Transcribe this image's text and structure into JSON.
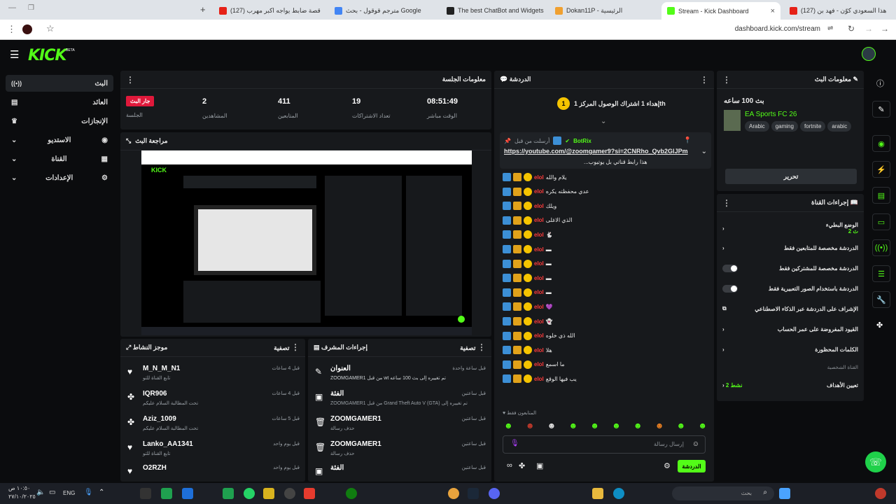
{
  "browser": {
    "tabs": [
      {
        "title": "(127) هذا السعودي كوّن - فهد بن",
        "color": "#e62117",
        "active": false
      },
      {
        "title": "Stream - Kick Dashboard",
        "color": "#53fc18",
        "active": true
      },
      {
        "title": "Dokan11P - الرئيسية",
        "color": "#f0a030",
        "active": false
      },
      {
        "title": "The best ChatBot and Widgets",
        "color": "#222222",
        "active": false
      },
      {
        "title": "مترجم قوقول - بحث Google",
        "color": "#4285f4",
        "active": false
      },
      {
        "title": "(127) قصة ضابط يواجه اكبر مهرب",
        "color": "#e62117",
        "active": false
      }
    ],
    "url": "dashboard.kick.com/stream"
  },
  "header": {
    "logo": "KICK",
    "beta": "BETA"
  },
  "nav": [
    {
      "label": "البث",
      "icon": "live-icon"
    },
    {
      "label": "العائد",
      "icon": "wallet-icon"
    },
    {
      "label": "الإنجازات",
      "icon": "trophy-icon"
    },
    {
      "label": "الاستديو",
      "icon": "studio-icon"
    },
    {
      "label": "القناة",
      "icon": "channel-icon"
    },
    {
      "label": "الإعدادات",
      "icon": "gear-icon"
    }
  ],
  "session": {
    "title": "معلومات الجلسة",
    "live_badge": "جار البث",
    "session_label": "الجلسة",
    "stats": [
      {
        "value": "2",
        "label": "المشاهدين"
      },
      {
        "value": "411",
        "label": "المتابعين"
      },
      {
        "value": "19",
        "label": "تعداد الاشتراكات"
      },
      {
        "value": "08:51:49",
        "label": "الوقت مباشر"
      }
    ]
  },
  "preview": {
    "title": "مراجعة البث"
  },
  "activity": {
    "title": "موجز النشاط",
    "filter": "تصفية",
    "items": [
      {
        "name": "M_N_M_N1",
        "sub": "تابع القناة للتو",
        "time": "قبل 4 ساعات",
        "icon": "heart-icon"
      },
      {
        "name": "IQR906",
        "sub": "تحت المطالبة السلام عليكم",
        "time": "قبل 4 ساعات",
        "icon": "gift-icon"
      },
      {
        "name": "Aziz_1009",
        "sub": "تحت المطالبة السلام عليكم",
        "time": "قبل 5 ساعات",
        "icon": "gift-icon"
      },
      {
        "name": "Lanko_AA1341",
        "sub": "تابع القناة للتو",
        "time": "قبل يوم واحد",
        "icon": "heart-icon"
      },
      {
        "name": "O2RZH",
        "sub": "",
        "time": "قبل يوم واحد",
        "icon": "heart-icon"
      }
    ]
  },
  "mod_actions": {
    "title": "إجراءات المشرف",
    "filter": "تصفية",
    "items": [
      {
        "name": "العنوان",
        "sub": "ZOOMGAMER1 من قبل wt تم تغييره إلى بث 100 ساعه",
        "time": "قبل ساعة واحدة",
        "icon": "edit-icon"
      },
      {
        "name": "الفئة",
        "sub": "ZOOMGAMER1 من قبل Grand Theft Auto V (GTA) تم تغييره إلى",
        "time": "قبل ساعتين",
        "icon": "category-icon"
      },
      {
        "name": "ZOOMGAMER1",
        "sub": "حذف رسالة",
        "time": "قبل ساعتين",
        "icon": "trash-icon"
      },
      {
        "name": "ZOOMGAMER1",
        "sub": "حذف رسالة",
        "time": "قبل ساعتين",
        "icon": "trash-icon"
      },
      {
        "name": "الفئة",
        "sub": "",
        "time": "قبل ساعتين",
        "icon": "category-icon"
      }
    ]
  },
  "chat": {
    "title": "الدردشة",
    "goal_badge": "1",
    "goal_text": "إهداء 1 اشتراك الوصول المركز 1th",
    "pinned_by": "أرسلت من قبل",
    "pinned_user": "BotRix",
    "pinned_link": "https://youtube.com/@zoomgamer9?si=2CNRho_Qvb2GlJPm",
    "pinned_desc": "...هذا رابط قناتي بل يوتيوب",
    "username": "elol",
    "messages": [
      "يلام والله",
      "عدي محفظته يكره",
      "ويلك",
      "الذي الاغلى",
      "🐇",
      "▬",
      "▬",
      "▬",
      "▬",
      "💜",
      "👻",
      "الله ذي خلوه",
      "هلا",
      "ما اسمع",
      "يب فيها الوقع"
    ],
    "followers_only": "المتابعون فقط",
    "input_placeholder": "إرسال رسالة",
    "send_button": "الدردشة"
  },
  "stream_info": {
    "title": "معلومات البث",
    "stream_title": "بث 100 ساعه",
    "category": "EA Sports FC 26",
    "tags": [
      "Arabic",
      "gaming",
      "fortnite",
      "arabic"
    ],
    "edit_button": "تحرير"
  },
  "channel_actions": {
    "title": "إجراءات القناة",
    "slow_mode": "الوضع البطيء",
    "slow_mode_value": "2 ث",
    "items": [
      {
        "label": "الدردشة مخصصة للمتابعين فقط",
        "control": "chevron"
      },
      {
        "label": "الدردشة مخصصة للمشتركين فقط",
        "control": "toggle"
      },
      {
        "label": "الدردشة باستخدام الصور التعبيرية فقط",
        "control": "toggle"
      },
      {
        "label": "الإشراف على الدردشة عبر الذكاء الاصطناعي",
        "control": "external"
      },
      {
        "label": "القيود المفروضة على عمر الحساب",
        "control": "chevron"
      },
      {
        "label": "الكلمات المحظورة",
        "control": "chevron"
      }
    ],
    "section_label": "القناة الشخصية",
    "goals_label": "تعيين الأهداف",
    "goals_value": "نشط 2"
  },
  "taskbar": {
    "lang": "ENG",
    "time": "١٠:٥٠ ص",
    "date": "٢٧/١٠/٢٠٢٥",
    "search": "بحث"
  }
}
